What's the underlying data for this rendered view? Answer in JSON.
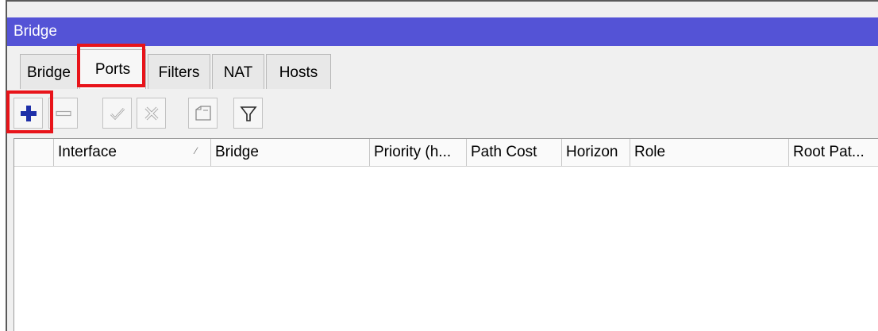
{
  "window": {
    "title": "Bridge"
  },
  "tabs": [
    {
      "label": "Bridge",
      "active": false
    },
    {
      "label": "Ports",
      "active": true
    },
    {
      "label": "Filters",
      "active": false
    },
    {
      "label": "NAT",
      "active": false
    },
    {
      "label": "Hosts",
      "active": false
    }
  ],
  "toolbar": {
    "buttons": [
      {
        "icon": "plus-icon",
        "enabled": true
      },
      {
        "icon": "minus-icon",
        "enabled": false
      },
      {
        "icon": "check-icon",
        "enabled": false
      },
      {
        "icon": "cross-icon",
        "enabled": false
      },
      {
        "icon": "comment-icon",
        "enabled": false
      },
      {
        "icon": "filter-icon",
        "enabled": true
      }
    ]
  },
  "table": {
    "columns": [
      {
        "label": "",
        "sorted": false
      },
      {
        "label": "Interface",
        "sorted": true
      },
      {
        "label": "Bridge",
        "sorted": false
      },
      {
        "label": "Priority (h...",
        "sorted": false
      },
      {
        "label": "Path Cost",
        "sorted": false
      },
      {
        "label": "Horizon",
        "sorted": false
      },
      {
        "label": "Role",
        "sorted": false
      },
      {
        "label": "Root Pat...",
        "sorted": false
      }
    ],
    "rows": []
  },
  "colors": {
    "title_bar": "#5453d6",
    "highlight": "#e8141a",
    "plus": "#1e2fa8"
  }
}
